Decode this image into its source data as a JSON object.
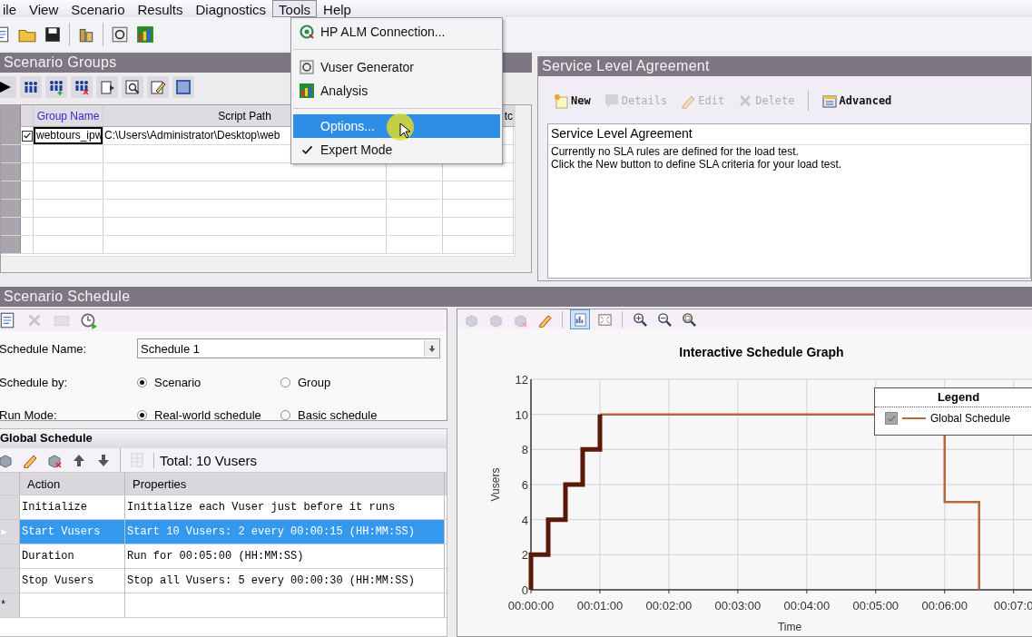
{
  "menu_bar": [
    {
      "label": "ile",
      "open": false
    },
    {
      "label": "View",
      "open": false
    },
    {
      "label": "Scenario",
      "open": false
    },
    {
      "label": "Results",
      "open": false
    },
    {
      "label": "Diagnostics",
      "open": false
    },
    {
      "label": "Tools",
      "open": true
    },
    {
      "label": "Help",
      "open": false
    }
  ],
  "tools_menu": [
    {
      "kind": "item",
      "label": "HP ALM Connection...",
      "selected": false,
      "checked": false
    },
    {
      "kind": "separator"
    },
    {
      "kind": "item",
      "label": "Vuser Generator",
      "selected": false,
      "checked": false
    },
    {
      "kind": "item",
      "label": "Analysis",
      "selected": false,
      "checked": false
    },
    {
      "kind": "separator"
    },
    {
      "kind": "item",
      "label": "Options...",
      "selected": true,
      "checked": false
    },
    {
      "kind": "item",
      "label": "Expert Mode",
      "selected": false,
      "checked": true
    }
  ],
  "scenario_groups": {
    "title": "Scenario Groups",
    "columns": [
      {
        "label": "Group Name",
        "color": "#2f2fd0"
      },
      {
        "label": "Script Path"
      },
      {},
      {
        "label": "tc"
      }
    ],
    "rows": [
      {
        "checked": true,
        "focused": true,
        "cells": [
          "webtours_ipw",
          "C:\\Users\\Administrator\\Desktop\\web"
        ]
      }
    ]
  },
  "sla": {
    "title": "Service Level Agreement",
    "toolbar": [
      {
        "kind": "button",
        "label": "New",
        "disabled": false
      },
      {
        "kind": "button",
        "label": "Details",
        "disabled": true
      },
      {
        "kind": "button",
        "label": "Edit",
        "disabled": true
      },
      {
        "kind": "button",
        "label": "Delete",
        "disabled": true
      },
      {
        "kind": "separator"
      },
      {
        "kind": "button",
        "label": "Advanced",
        "disabled": false
      }
    ],
    "heading": "Service Level Agreement",
    "lines": [
      "Currently no SLA rules are defined for the load test.",
      "Click the New button to define SLA criteria for your load test."
    ]
  },
  "schedule": {
    "title": "Scenario Schedule",
    "toolbar": [
      {
        "disabled": false
      },
      {
        "disabled": true
      },
      {
        "disabled": true
      },
      {
        "disabled": false
      }
    ],
    "schedule_name": {
      "label": "Schedule Name:",
      "value": "Schedule 1"
    },
    "schedule_by": {
      "label": "Schedule by:",
      "options": [
        {
          "label": "Scenario",
          "selected": true
        },
        {
          "label": "Group",
          "selected": false
        }
      ]
    },
    "run_mode": {
      "label": "Run Mode:",
      "options": [
        {
          "label": "Real-world schedule",
          "selected": true
        },
        {
          "label": "Basic schedule",
          "selected": false
        }
      ]
    },
    "global_schedule": {
      "title": "Global Schedule",
      "toolbar": [
        {
          "disabled": false
        },
        {
          "disabled": false
        },
        {
          "disabled": false
        },
        {
          "disabled": false
        },
        {
          "disabled": false
        },
        {
          "disabled": true
        }
      ],
      "total": "Total: 10 Vusers",
      "columns": [
        "Action",
        "Properties"
      ],
      "rows": [
        {
          "action": "Initialize",
          "properties": "Initialize each Vuser just before it runs",
          "selected": false
        },
        {
          "action": "Start Vusers",
          "properties": "Start 10 Vusers: 2 every 00:00:15 (HH:MM:SS)",
          "selected": true
        },
        {
          "action": "Duration",
          "properties": "Run for 00:05:00 (HH:MM:SS)",
          "selected": false
        },
        {
          "action": "Stop Vusers",
          "properties": "Stop all Vusers: 5 every 00:00:30 (HH:MM:SS)",
          "selected": false
        }
      ],
      "new_row_marker": "*"
    }
  },
  "graph": {
    "toolbar": [
      {
        "disabled": true,
        "pressed": false
      },
      {
        "disabled": true,
        "pressed": false
      },
      {
        "disabled": true,
        "pressed": false
      },
      {
        "disabled": false,
        "pressed": false
      },
      {
        "disabled": false,
        "pressed": true
      },
      {
        "disabled": false,
        "pressed": false
      },
      {
        "disabled": false,
        "pressed": false
      },
      {
        "disabled": false,
        "pressed": false
      },
      {
        "disabled": false,
        "pressed": false
      }
    ],
    "legend": {
      "title": "Legend",
      "checked": true
    },
    "chart_data": {
      "type": "line",
      "title": "Interactive Schedule Graph",
      "xlabel": "Time",
      "ylabel": "Vusers",
      "grid": true,
      "x": [
        0,
        0,
        0.25,
        0.25,
        0.5,
        0.5,
        0.75,
        0.75,
        1,
        1,
        4.98,
        6,
        6,
        6.5,
        6.5
      ],
      "series": [
        {
          "name": "Global Schedule",
          "color": "#b8693c",
          "values": [
            null,
            null,
            null,
            null,
            null,
            null,
            null,
            null,
            null,
            10,
            10,
            null,
            null,
            null,
            null
          ]
        },
        {
          "color": "#5a1806",
          "values": [
            0,
            2,
            2,
            4,
            4,
            6,
            6,
            8,
            8,
            10,
            null,
            null,
            null,
            null,
            null
          ]
        },
        {
          "color": "#b8693c",
          "values": [
            null,
            null,
            null,
            null,
            null,
            null,
            null,
            null,
            null,
            null,
            null,
            8.8,
            5,
            5,
            0
          ]
        }
      ],
      "xlim": [
        0,
        7.28
      ],
      "ylim": [
        0,
        12
      ],
      "xticks": [
        {
          "value": 0,
          "label": "00:00:00"
        },
        {
          "value": 1,
          "label": "00:01:00"
        },
        {
          "value": 2,
          "label": "00:02:00"
        },
        {
          "value": 3,
          "label": "00:03:00"
        },
        {
          "value": 4,
          "label": "00:04:00"
        },
        {
          "value": 5,
          "label": "00:05:00"
        },
        {
          "value": 6,
          "label": "00:06:00"
        },
        {
          "value": 7,
          "label": "00:07:0"
        }
      ],
      "yticks": [
        0,
        2,
        4,
        6,
        8,
        10,
        12
      ]
    }
  }
}
